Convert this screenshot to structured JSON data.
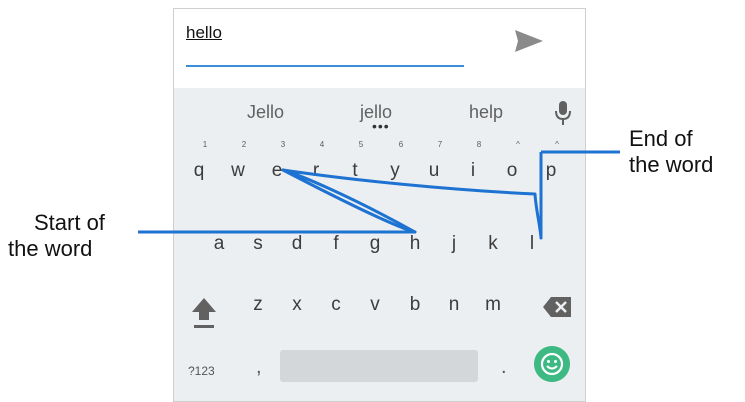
{
  "input": {
    "text": "hello"
  },
  "suggestions": [
    "Jello",
    "jello",
    "help"
  ],
  "rows": {
    "row1": [
      "q",
      "w",
      "e",
      "r",
      "t",
      "y",
      "u",
      "i",
      "o",
      "p"
    ],
    "row1_hints": [
      "1",
      "2",
      "3",
      "4",
      "5",
      "6",
      "7",
      "8",
      "^",
      "^"
    ],
    "row2": [
      "a",
      "s",
      "d",
      "f",
      "g",
      "h",
      "j",
      "k",
      "l"
    ],
    "row3": [
      "z",
      "x",
      "c",
      "v",
      "b",
      "n",
      "m"
    ]
  },
  "bottom_row": {
    "symbols_label": "?123",
    "comma": ",",
    "period": "."
  },
  "callouts": {
    "start": [
      "Start of",
      "the word"
    ],
    "end": [
      "End of",
      "the word"
    ]
  },
  "icons": {
    "send": "send-icon",
    "mic": "microphone-icon",
    "shift": "shift-icon",
    "backspace": "backspace-icon",
    "emoji": "emoji-icon"
  },
  "colors": {
    "accent": "#3b8fd9",
    "swipe_trail": "#1e73d2",
    "emoji_bg": "#3dba84",
    "keyboard_bg": "#eceff1"
  }
}
